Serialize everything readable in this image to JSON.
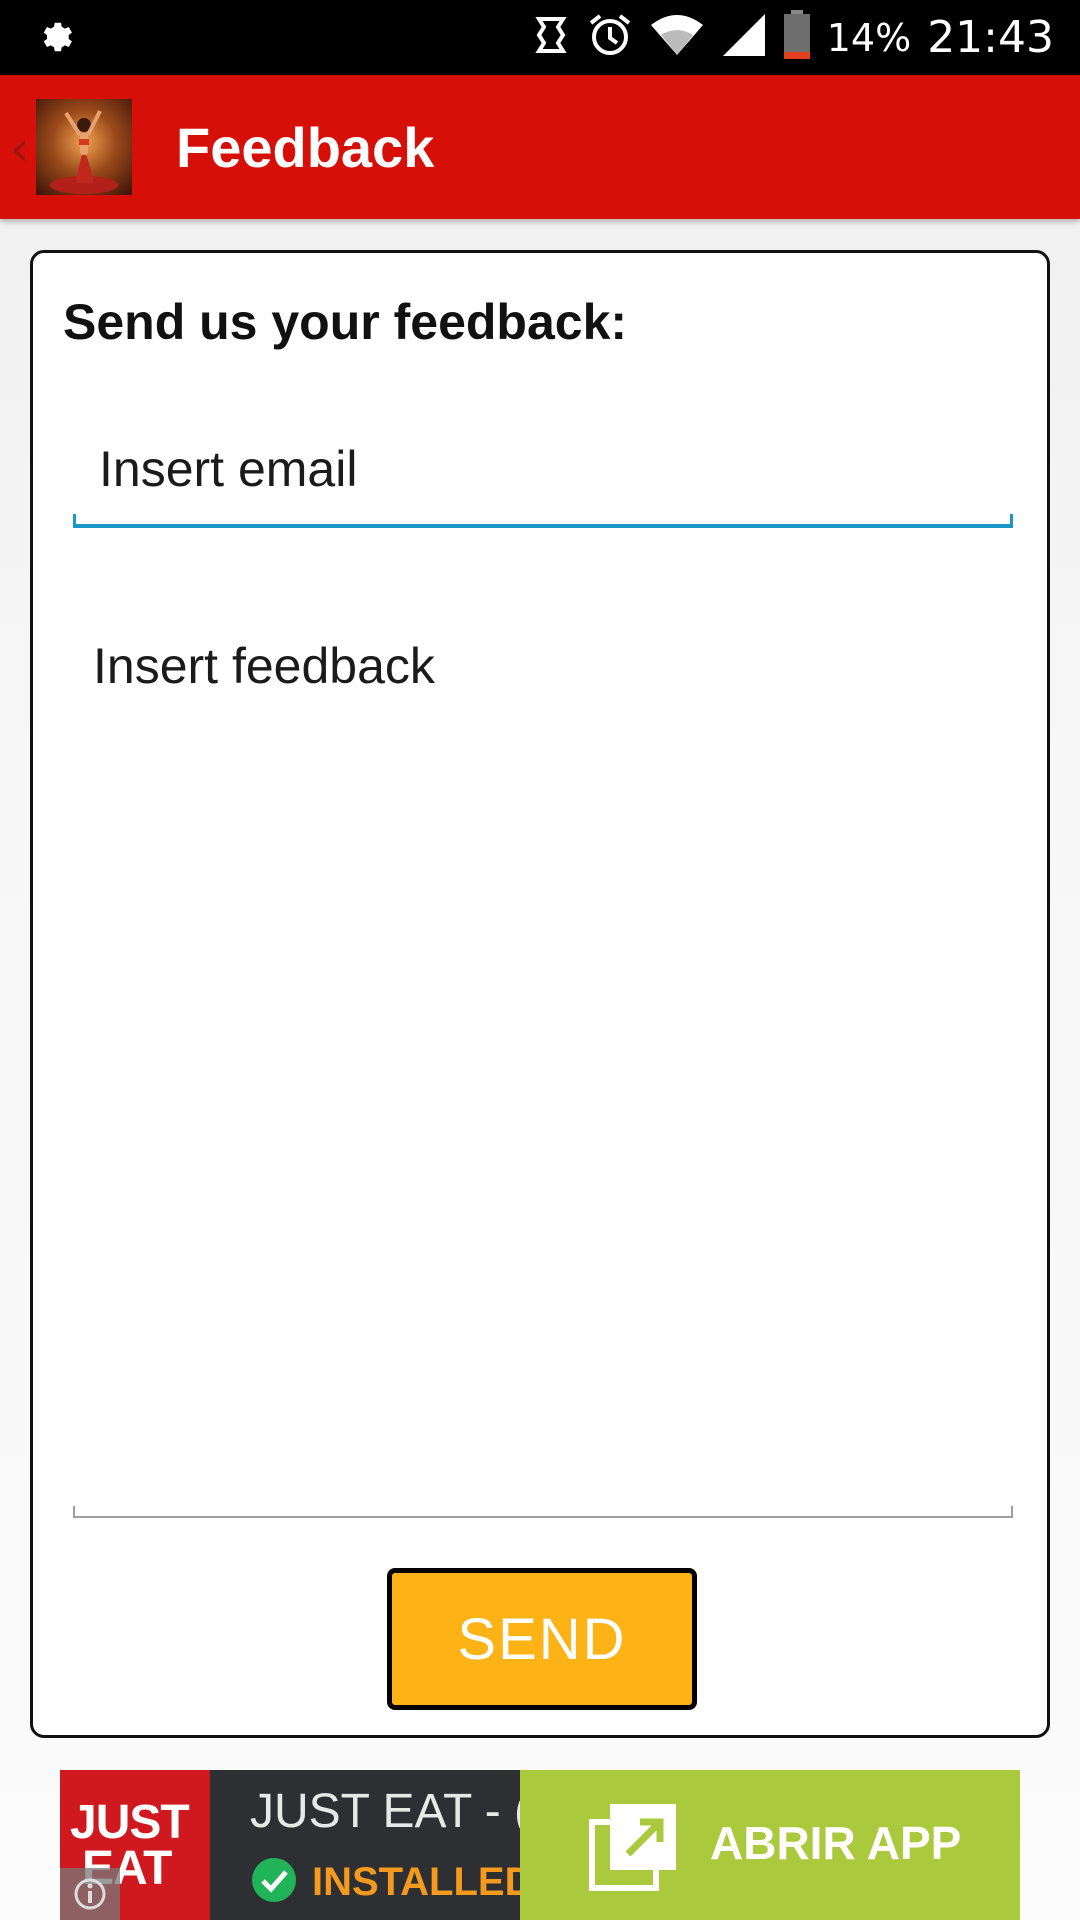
{
  "status_bar": {
    "battery": "14%",
    "time": "21:43",
    "icons": [
      "settings-gear-icon",
      "sync-icon",
      "alarm-icon",
      "wifi-icon",
      "signal-icon",
      "battery-icon"
    ]
  },
  "app_bar": {
    "title": "Feedback",
    "back_glyph": "‹",
    "color": "#d60f08"
  },
  "form": {
    "heading": "Send us your feedback:",
    "email_placeholder": "Insert email",
    "feedback_placeholder": "Insert feedback",
    "send_label": "SEND",
    "send_color": "#fdb316",
    "focus_color": "#1a96c9"
  },
  "ad": {
    "logo_line1": "JUST",
    "logo_line2": "EAT",
    "app_name": "JUST EAT - (",
    "status": "INSTALLED",
    "cta_label": "ABRIR APP",
    "cta_color": "#abc93c"
  }
}
